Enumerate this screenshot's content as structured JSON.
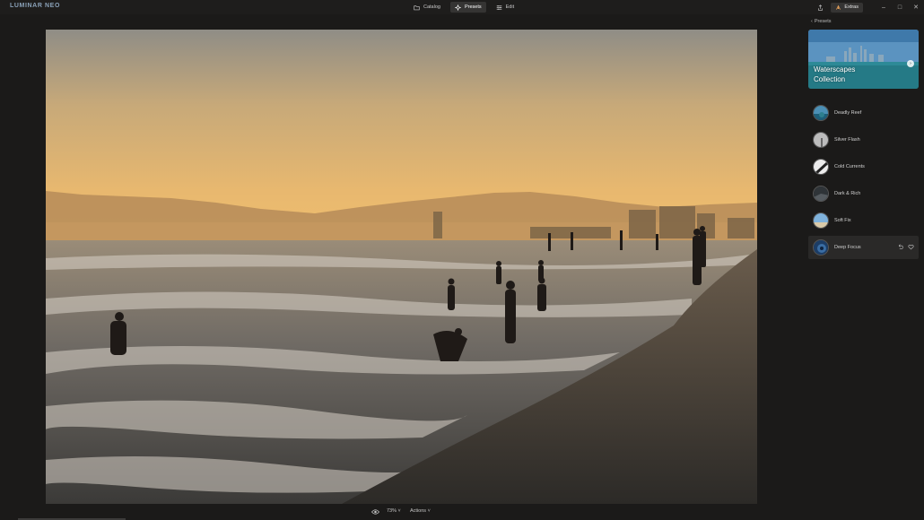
{
  "app": {
    "logo": "LUMINAR NEO"
  },
  "modes": [
    {
      "label": "Catalog",
      "icon": "folder-icon"
    },
    {
      "label": "Presets",
      "icon": "presets-icon"
    },
    {
      "label": "Edit",
      "icon": "sliders-icon"
    }
  ],
  "topbar": {
    "extras_label": "Extras"
  },
  "window_controls": {
    "minimize": "–",
    "maximize": "□",
    "close": "✕"
  },
  "panel": {
    "back_label": "Presets",
    "collection": {
      "line1": "Waterscapes",
      "line2": "Collection",
      "arrow": "›"
    },
    "presets": [
      {
        "name": "Deadly Reef",
        "active": false
      },
      {
        "name": "Silver Flash",
        "active": false
      },
      {
        "name": "Cold Currents",
        "active": false
      },
      {
        "name": "Dark & Rich",
        "active": false
      },
      {
        "name": "Soft Fix",
        "active": false
      },
      {
        "name": "Deep Focus",
        "active": true
      }
    ]
  },
  "bottombar": {
    "zoom": "73% ˅",
    "actions": "Actions ˅"
  },
  "colors": {
    "background": "#1b1a19",
    "active_tab": "#353433",
    "panel_active": "#2a2928"
  }
}
